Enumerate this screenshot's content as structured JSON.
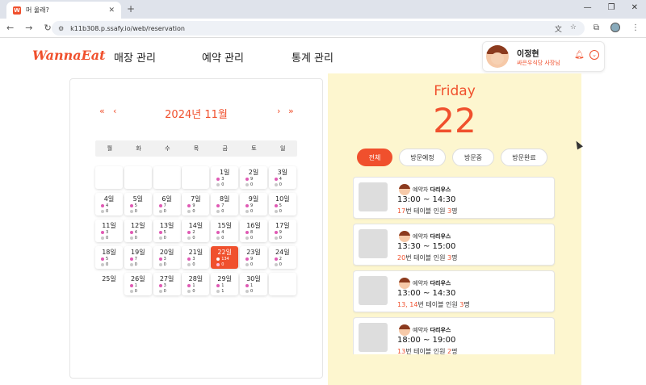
{
  "browser": {
    "tab_title": "머 울래?",
    "favicon_text": "W",
    "url": "k11b308.p.ssafy.io/web/reservation"
  },
  "header": {
    "logo": "WannaEat",
    "nav": [
      "매장 관리",
      "예약 관리",
      "통계 관리"
    ],
    "user_name": "이정현",
    "user_role": "싸은우식당 사장님"
  },
  "calendar": {
    "title": "2024년 11월",
    "prev_year": "«",
    "prev_month": "‹",
    "next_month": "›",
    "next_year": "»",
    "weekdays": [
      "월",
      "화",
      "수",
      "목",
      "금",
      "토",
      "일"
    ],
    "days": [
      {
        "label": "1일",
        "a": "3",
        "b": "0"
      },
      {
        "label": "2일",
        "a": "9",
        "b": "0"
      },
      {
        "label": "3일",
        "a": "4",
        "b": "0"
      },
      {
        "label": "4일",
        "a": "4",
        "b": "0"
      },
      {
        "label": "5일",
        "a": "5",
        "b": "0"
      },
      {
        "label": "6일",
        "a": "7",
        "b": "0"
      },
      {
        "label": "7일",
        "a": "9",
        "b": "0"
      },
      {
        "label": "8일",
        "a": "7",
        "b": "0"
      },
      {
        "label": "9일",
        "a": "9",
        "b": "0"
      },
      {
        "label": "10일",
        "a": "5",
        "b": "0"
      },
      {
        "label": "11일",
        "a": "3",
        "b": "0"
      },
      {
        "label": "12일",
        "a": "4",
        "b": "0"
      },
      {
        "label": "13일",
        "a": "5",
        "b": "0"
      },
      {
        "label": "14일",
        "a": "2",
        "b": "0"
      },
      {
        "label": "15일",
        "a": "4",
        "b": "0"
      },
      {
        "label": "16일",
        "a": "8",
        "b": "0"
      },
      {
        "label": "17일",
        "a": "9",
        "b": "0"
      },
      {
        "label": "18일",
        "a": "5",
        "b": "0"
      },
      {
        "label": "19일",
        "a": "7",
        "b": "0"
      },
      {
        "label": "20일",
        "a": "3",
        "b": "0"
      },
      {
        "label": "21일",
        "a": "3",
        "b": "0"
      },
      {
        "label": "22일",
        "a": "134",
        "b": "0"
      },
      {
        "label": "23일",
        "a": "9",
        "b": "0"
      },
      {
        "label": "24일",
        "a": "2",
        "b": "0"
      },
      {
        "label": "25일",
        "a": "",
        "b": ""
      },
      {
        "label": "26일",
        "a": "1",
        "b": "0"
      },
      {
        "label": "27일",
        "a": "3",
        "b": "0"
      },
      {
        "label": "28일",
        "a": "1",
        "b": "0"
      },
      {
        "label": "29일",
        "a": "1",
        "b": "1"
      },
      {
        "label": "30일",
        "a": "1",
        "b": "0"
      }
    ],
    "selected_day": "22일",
    "colors": {
      "dot_a": "#e05ab4",
      "dot_b": "#c8c8c8",
      "accent": "#f0502d"
    }
  },
  "detail": {
    "weekday": "Friday",
    "day": "22",
    "filters": [
      "전체",
      "방문예정",
      "방문중",
      "방문완료"
    ],
    "active_filter": "전체",
    "reservations": [
      {
        "prefix": "예약자",
        "name": "다리우스",
        "time": "13:00 ~ 14:30",
        "table": "17",
        "table_suffix": "번 테이블",
        "people_label": "인원",
        "people": "3",
        "people_suffix": "명"
      },
      {
        "prefix": "예약자",
        "name": "다리우스",
        "time": "13:30 ~ 15:00",
        "table": "20",
        "table_suffix": "번 테이블",
        "people_label": "인원",
        "people": "3",
        "people_suffix": "명"
      },
      {
        "prefix": "예약자",
        "name": "다리우스",
        "time": "13:00 ~ 14:30",
        "table": "13, 14",
        "table_suffix": "번 테이블",
        "people_label": "인원",
        "people": "3",
        "people_suffix": "명"
      },
      {
        "prefix": "예약자",
        "name": "다리우스",
        "time": "18:00 ~ 19:00",
        "table": "13",
        "table_suffix": "번 테이블",
        "people_label": "인원",
        "people": "2",
        "people_suffix": "명"
      }
    ]
  }
}
